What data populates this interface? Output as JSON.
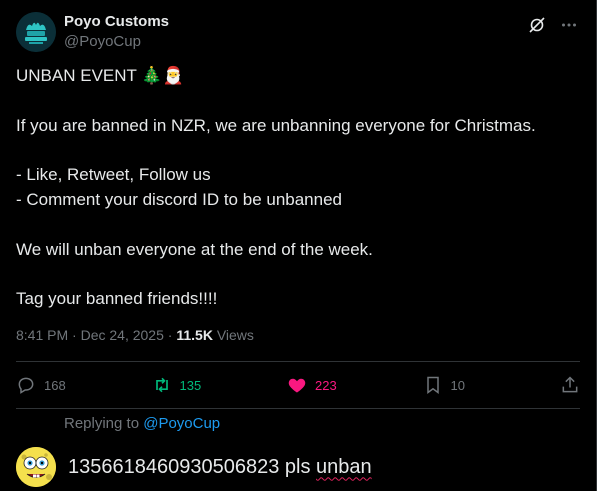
{
  "author": {
    "display_name": "Poyo Customs",
    "handle": "@PoyoCup"
  },
  "header": {
    "grok_icon": "grok-icon",
    "more_icon": "more-icon"
  },
  "tweet": {
    "line1_text": "UNBAN EVENT ",
    "line1_emoji_tree": "🎄",
    "line1_emoji_santa": "🎅",
    "line3": "If you are banned in NZR, we are unbanning everyone for Christmas.",
    "line5": "- Like, Retweet, Follow us",
    "line6": "- Comment your discord ID to be unbanned",
    "line8": "We will unban everyone at the end of the week.",
    "line10": "Tag your banned friends!!!!"
  },
  "meta": {
    "time": "8:41 PM",
    "separator1": "·",
    "date": "Dec 24, 2025",
    "separator2": "·",
    "views_count": "11.5K",
    "views_label": "Views"
  },
  "actions": {
    "replies": "168",
    "retweets": "135",
    "likes": "223",
    "bookmarks": "10"
  },
  "reply": {
    "replying_to_label": "Replying to ",
    "replying_to_handle": "@PoyoCup",
    "draft_id": "1356618460930506823",
    "draft_rest_plain": " pls ",
    "draft_rest_spell": "unban"
  },
  "colors": {
    "background": "#000000",
    "text_primary": "#e7e9ea",
    "text_secondary": "#71767b",
    "retweet_green": "#00ba7c",
    "like_pink": "#f91880",
    "link_blue": "#1d9bf0",
    "spellcheck_red": "#e0245e"
  }
}
